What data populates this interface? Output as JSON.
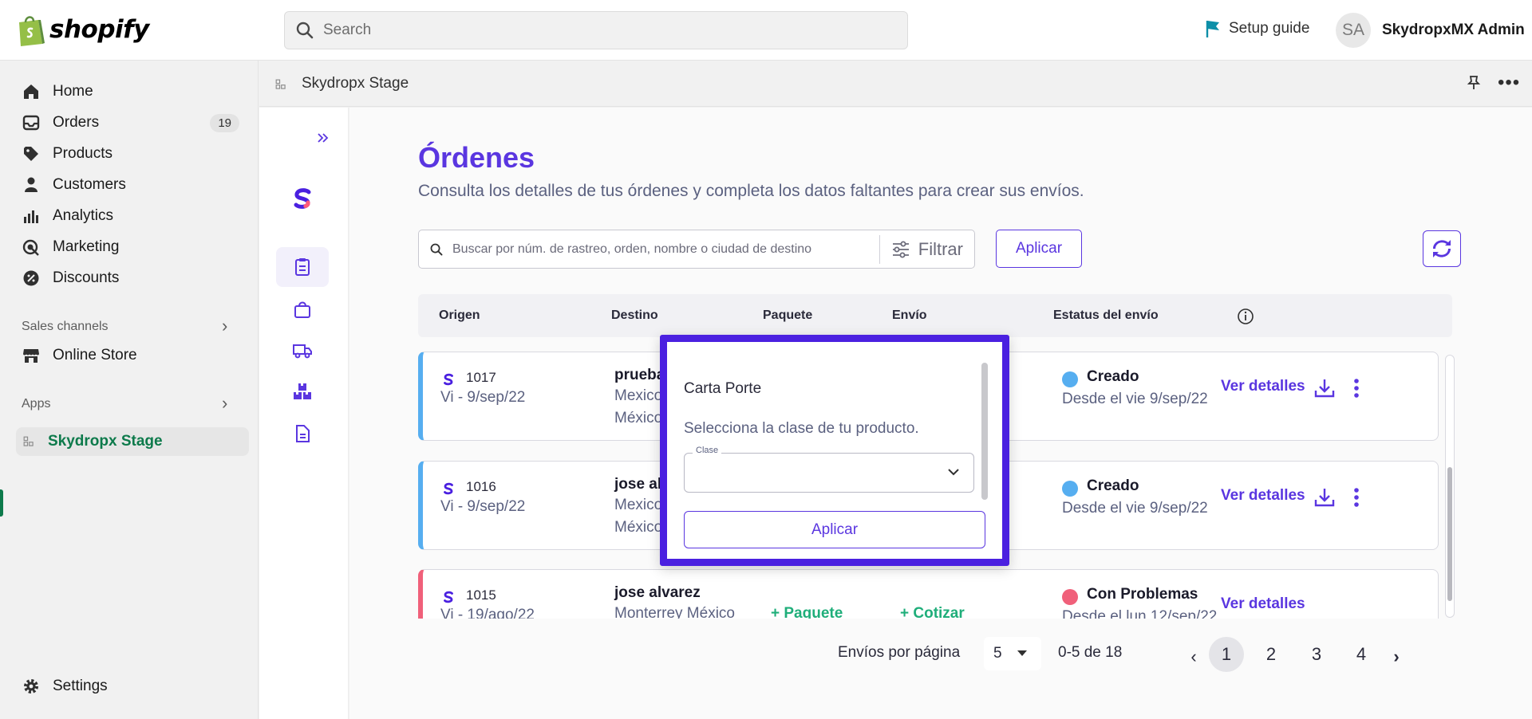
{
  "topbar": {
    "brand": "shopify",
    "search_placeholder": "Search",
    "setup_guide": "Setup guide",
    "user_initials": "SA",
    "user_name": "SkydropxMX Admin"
  },
  "sidebar": {
    "items": [
      {
        "label": "Home",
        "icon": "home-icon"
      },
      {
        "label": "Orders",
        "icon": "orders-icon",
        "badge": "19"
      },
      {
        "label": "Products",
        "icon": "tag-icon"
      },
      {
        "label": "Customers",
        "icon": "person-icon"
      },
      {
        "label": "Analytics",
        "icon": "bar-chart-icon"
      },
      {
        "label": "Marketing",
        "icon": "target-icon"
      },
      {
        "label": "Discounts",
        "icon": "discount-icon"
      }
    ],
    "sales_channels_label": "Sales channels",
    "online_store": "Online Store",
    "apps_label": "Apps",
    "active_app": "Skydropx Stage",
    "settings": "Settings"
  },
  "app_header": {
    "app_name": "Skydropx Stage"
  },
  "page": {
    "title": "Órdenes",
    "subtitle": "Consulta los detalles de tus órdenes y completa los datos faltantes para crear sus envíos.",
    "search_placeholder": "Buscar por núm. de rastreo, orden, nombre o ciudad de destino",
    "filter_label": "Filtrar",
    "apply_label": "Aplicar"
  },
  "table": {
    "headers": [
      "Origen",
      "Destino",
      "Paquete",
      "Envío",
      "Estatus del envío"
    ],
    "rows": [
      {
        "order": "1017",
        "date": "Vi - 9/sep/22",
        "dest_name": "prueba",
        "dest_line1": "Mexico",
        "dest_line2": "México",
        "status": "Creado",
        "status_color": "#56aef0",
        "since": "Desde el vie 9/sep/22",
        "details": "Ver detalles"
      },
      {
        "order": "1016",
        "date": "Vi - 9/sep/22",
        "dest_name": "jose al",
        "dest_line1": "Mexico",
        "dest_line2": "México",
        "status": "Creado",
        "status_color": "#56aef0",
        "since": "Desde el vie 9/sep/22",
        "details": "Ver detalles"
      },
      {
        "order": "1015",
        "date": "Vi - 19/ago/22",
        "dest_name": "jose alvarez",
        "dest_line1": "Monterrey México",
        "paquete": "Paquete",
        "cotizar": "Cotizar",
        "status": "Con Problemas",
        "status_color": "#f0607a",
        "since": "Desde el lun 12/sep/22",
        "details": "Ver detalles"
      }
    ]
  },
  "pagination": {
    "per_page_label": "Envíos por página",
    "per_page_value": "5",
    "range": "0-5 de 18",
    "pages": [
      "1",
      "2",
      "3",
      "4"
    ],
    "current": "1"
  },
  "popover": {
    "title": "Carta Porte",
    "description": "Selecciona la clase de tu producto.",
    "field_label": "Clase",
    "field_value": "",
    "button": "Aplicar"
  },
  "colors": {
    "accent": "#5a36e0",
    "popover_border": "#4a20e0",
    "shopify_green": "#0d7a4b",
    "positive": "#1fae7a"
  }
}
